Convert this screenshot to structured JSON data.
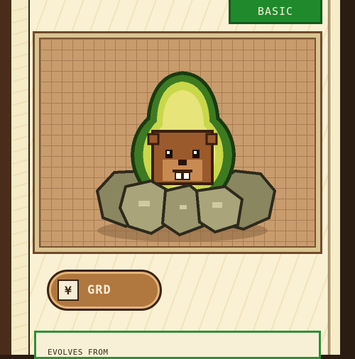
{
  "card": {
    "rarity": "BASIC",
    "type_label": "GRD",
    "type_icon_glyph": "¥",
    "evolves_from_label": "EVOLVES FROM",
    "creature_icon": "avocado-beaver-creature-icon"
  },
  "colors": {
    "rarity_badge": "#1f8a2c",
    "type_pill": "#b0773f",
    "art_background": "#c99c6e",
    "card_cream": "#faf1d4"
  }
}
